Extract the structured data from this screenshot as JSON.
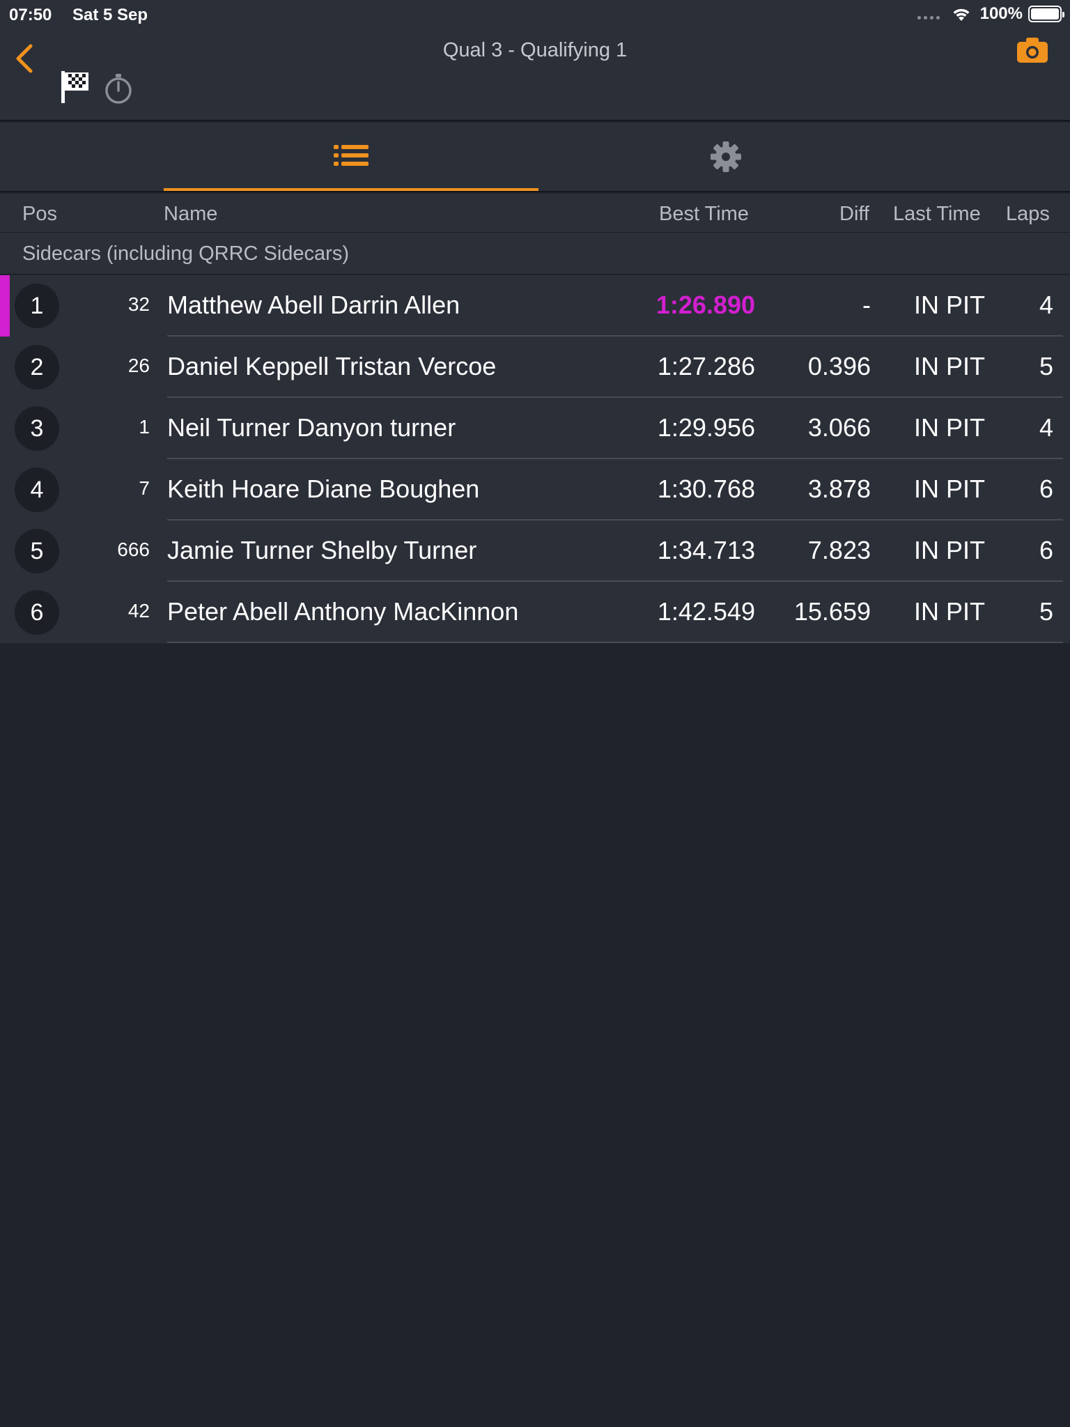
{
  "status_bar": {
    "time": "07:50",
    "date": "Sat 5 Sep",
    "battery_percent": "100%"
  },
  "nav": {
    "title": "Qual 3 -   Qualifying 1",
    "back_icon": "chevron-left-icon",
    "camera_icon": "camera-icon",
    "flag_icon": "checkered-flag-icon",
    "stopwatch_icon": "stopwatch-icon"
  },
  "tabs": [
    {
      "name": "results-list",
      "icon": "list-icon",
      "active": true
    },
    {
      "name": "settings",
      "icon": "gear-icon",
      "active": false
    }
  ],
  "columns": {
    "pos": "Pos",
    "name": "Name",
    "best_time": "Best Time",
    "diff": "Diff",
    "last_time": "Last Time",
    "laps": "Laps"
  },
  "group_title": "Sidecars (including QRRC Sidecars)",
  "colors": {
    "accent": "#f0921e",
    "fastest": "#d21fd0",
    "background": "#20232b",
    "panel": "#2b2f38"
  },
  "rows": [
    {
      "pos": "1",
      "number": "32",
      "name": "Matthew Abell Darrin Allen",
      "best_time": "1:26.890",
      "diff": "-",
      "last_time": "IN PIT",
      "laps": "4"
    },
    {
      "pos": "2",
      "number": "26",
      "name": "Daniel Keppell Tristan Vercoe",
      "best_time": "1:27.286",
      "diff": "0.396",
      "last_time": "IN PIT",
      "laps": "5"
    },
    {
      "pos": "3",
      "number": "1",
      "name": "Neil Turner Danyon turner",
      "best_time": "1:29.956",
      "diff": "3.066",
      "last_time": "IN PIT",
      "laps": "4"
    },
    {
      "pos": "4",
      "number": "7",
      "name": "Keith Hoare Diane Boughen",
      "best_time": "1:30.768",
      "diff": "3.878",
      "last_time": "IN PIT",
      "laps": "6"
    },
    {
      "pos": "5",
      "number": "666",
      "name": "Jamie Turner Shelby Turner",
      "best_time": "1:34.713",
      "diff": "7.823",
      "last_time": "IN PIT",
      "laps": "6"
    },
    {
      "pos": "6",
      "number": "42",
      "name": "Peter Abell Anthony MacKinnon",
      "best_time": "1:42.549",
      "diff": "15.659",
      "last_time": "IN PIT",
      "laps": "5"
    }
  ]
}
